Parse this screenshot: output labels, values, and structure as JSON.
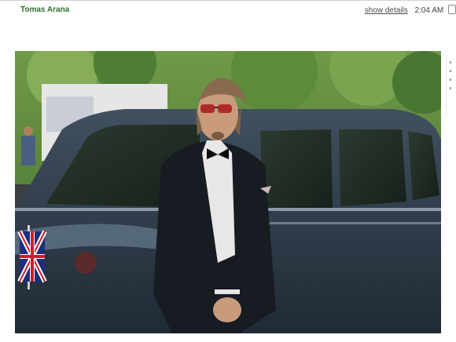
{
  "message": {
    "sender": "Tomas Arana",
    "show_details_label": "show details",
    "time": "2:04 AM"
  },
  "icons": {
    "reply_menu": "menu-dropdown-icon"
  },
  "colors": {
    "sender": "#2e6b2e",
    "link": "#4a4a4a"
  }
}
